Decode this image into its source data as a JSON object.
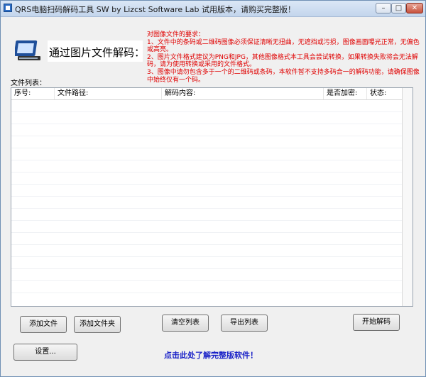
{
  "window": {
    "title": "QRS电脑扫码解码工具  SW  by Lizcst Software Lab 试用版本，请购买完整版！",
    "controls": {
      "minimize": "–",
      "maximize": "□",
      "close": "✕"
    }
  },
  "header": {
    "heading": "通过图片文件解码：",
    "requirements": [
      "对图像文件的要求：",
      "1、文件中的条码或二维码图像必须保证清晰无扭曲，无遮挡或污损，图像画面曝光正常，无偏色或高亮。",
      "2、图片文件格式建议为PNG和JPG，其他图像格式本工具会尝试转换，如果转换失败将会无法解码，请为使用转换或采用的文件格式。",
      "3、图像中请勿包含多于一个的二维码或条码，本软件暂不支持多码合一的解码功能，请确保图像中始终仅有一个码。"
    ]
  },
  "file_list": {
    "caption": "文件列表：",
    "columns": [
      "序号:",
      "文件路径:",
      "解码内容:",
      "是否加密:",
      "状态:"
    ]
  },
  "buttons": {
    "add_file": "添加文件",
    "add_folder": "添加文件夹",
    "clear_list": "清空列表",
    "export_list": "导出列表",
    "start_decode": "开始解码",
    "settings": "设置..."
  },
  "footer": {
    "buy_link": "点击此处了解完整版软件！"
  },
  "icons": {
    "app": "app-icon",
    "scanner": "scanner-icon"
  }
}
